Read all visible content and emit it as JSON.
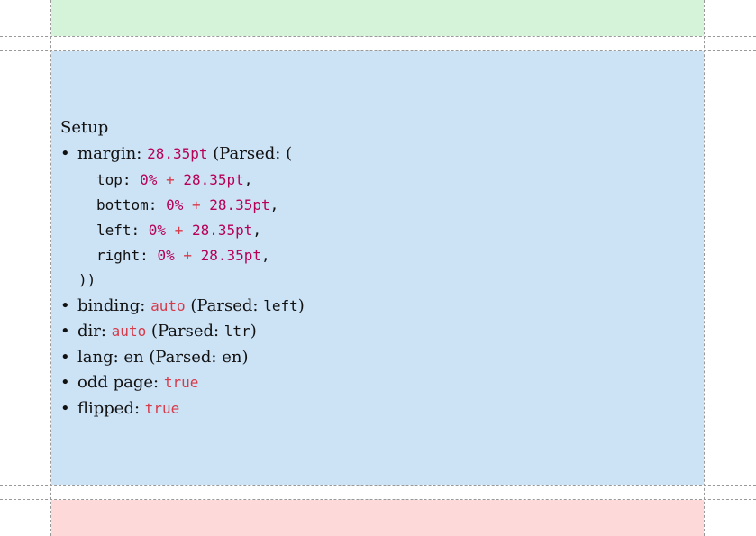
{
  "heading": "Setup",
  "margin": {
    "label": "margin: ",
    "value": "28.35pt",
    "parsed_open": " (Parsed: (",
    "entries": [
      {
        "key": "top: ",
        "pct": "0%",
        "op": " + ",
        "val": "28.35pt",
        "comma": ","
      },
      {
        "key": "bottom: ",
        "pct": "0%",
        "op": " + ",
        "val": "28.35pt",
        "comma": ","
      },
      {
        "key": "left: ",
        "pct": "0%",
        "op": " + ",
        "val": "28.35pt",
        "comma": ","
      },
      {
        "key": "right: ",
        "pct": "0%",
        "op": " + ",
        "val": "28.35pt",
        "comma": ","
      }
    ],
    "close": "))"
  },
  "binding": {
    "label": "binding: ",
    "value": "auto",
    "parsed_pre": " (Parsed: ",
    "parsed": "left",
    "close": ")"
  },
  "dir": {
    "label": "dir: ",
    "value": "auto",
    "parsed_pre": " (Parsed: ",
    "parsed": "ltr",
    "close": ")"
  },
  "lang": {
    "text": "lang: en (Parsed: en)"
  },
  "odd_page": {
    "label": "odd page: ",
    "value": "true"
  },
  "flipped": {
    "label": "flipped: ",
    "value": "true"
  },
  "bullet": "•"
}
